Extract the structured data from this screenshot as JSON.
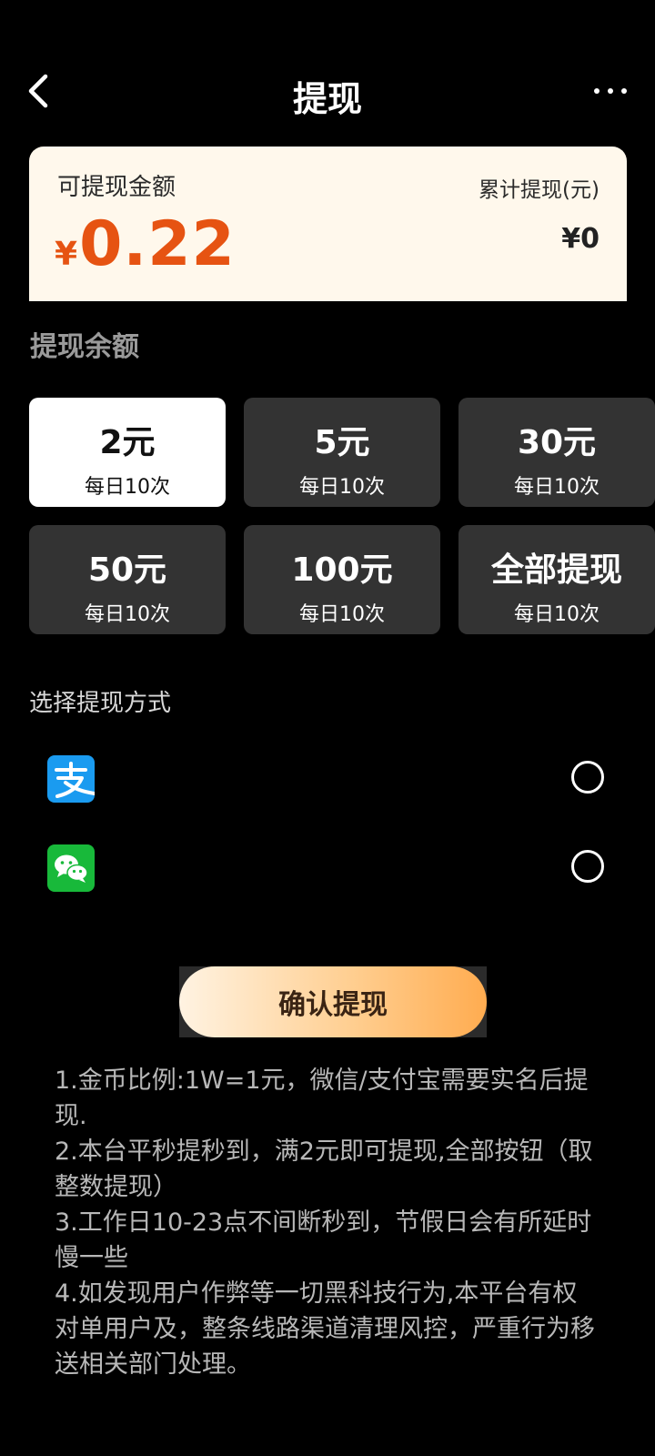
{
  "header": {
    "title": "提现"
  },
  "balance": {
    "label": "可提现金额",
    "currency": "¥",
    "amount": "0.22",
    "cumulative_label": "累计提现(元)",
    "cumulative_value": "¥0"
  },
  "amount_section": {
    "title": "提现余额",
    "selected_index": 0,
    "options": [
      {
        "amount": "2元",
        "limit": "每日10次"
      },
      {
        "amount": "5元",
        "limit": "每日10次"
      },
      {
        "amount": "30元",
        "limit": "每日10次"
      },
      {
        "amount": "50元",
        "limit": "每日10次"
      },
      {
        "amount": "100元",
        "limit": "每日10次"
      },
      {
        "amount": "全部提现",
        "limit": "每日10次"
      }
    ]
  },
  "methods": {
    "title": "选择提现方式",
    "items": [
      {
        "icon": "alipay-icon",
        "color": "#1a9bf0"
      },
      {
        "icon": "wechat-icon",
        "color": "#18b93a"
      }
    ]
  },
  "confirm": {
    "label": "确认提现"
  },
  "notes": [
    "1.金币比例:1W=1元，微信/支付宝需要实名后提现.",
    "2.本台平秒提秒到，满2元即可提现,全部按钮（取整数提现）",
    "3.工作日10-23点不间断秒到，节假日会有所延时慢一些",
    "4.如发现用户作弊等一切黑科技行为,本平台有权对单用户及，整条线路渠道清理风控，严重行为移送相关部门处理。"
  ],
  "colors": {
    "accent": "#e65312",
    "card_bg": "#fff8ec",
    "option_bg": "#333333",
    "selected_bg": "#ffffff"
  }
}
